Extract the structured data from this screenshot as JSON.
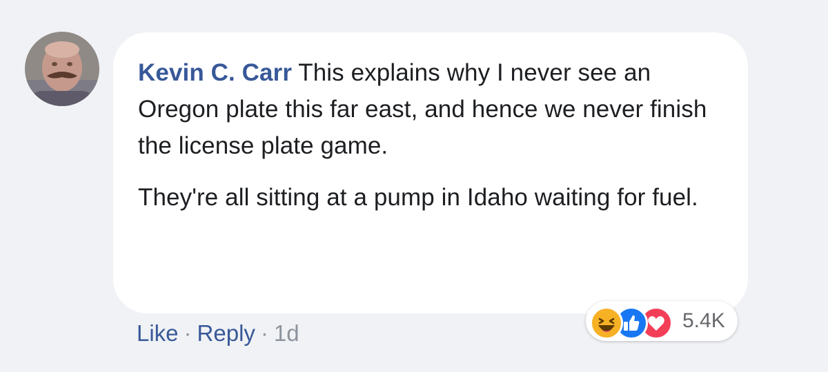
{
  "comment": {
    "author": "Kevin C. Carr",
    "text_paragraph_1": "This explains why I never see an Oregon plate this far east, and hence we never finish the license plate game.",
    "text_paragraph_2": "They're all sitting at a pump in Idaho waiting for fuel.",
    "reaction_count": "5.4K",
    "reactions": [
      "haha-icon",
      "like-icon",
      "love-icon"
    ]
  },
  "actions": {
    "like_label": "Like",
    "separator": "·",
    "reply_label": "Reply",
    "timestamp": "1d"
  },
  "colors": {
    "author_link": "#385898",
    "page_background": "#f0f2f5",
    "bubble_background": "#ffffff",
    "haha": "#f7b125",
    "like": "#1877f2",
    "love": "#f33e58"
  }
}
